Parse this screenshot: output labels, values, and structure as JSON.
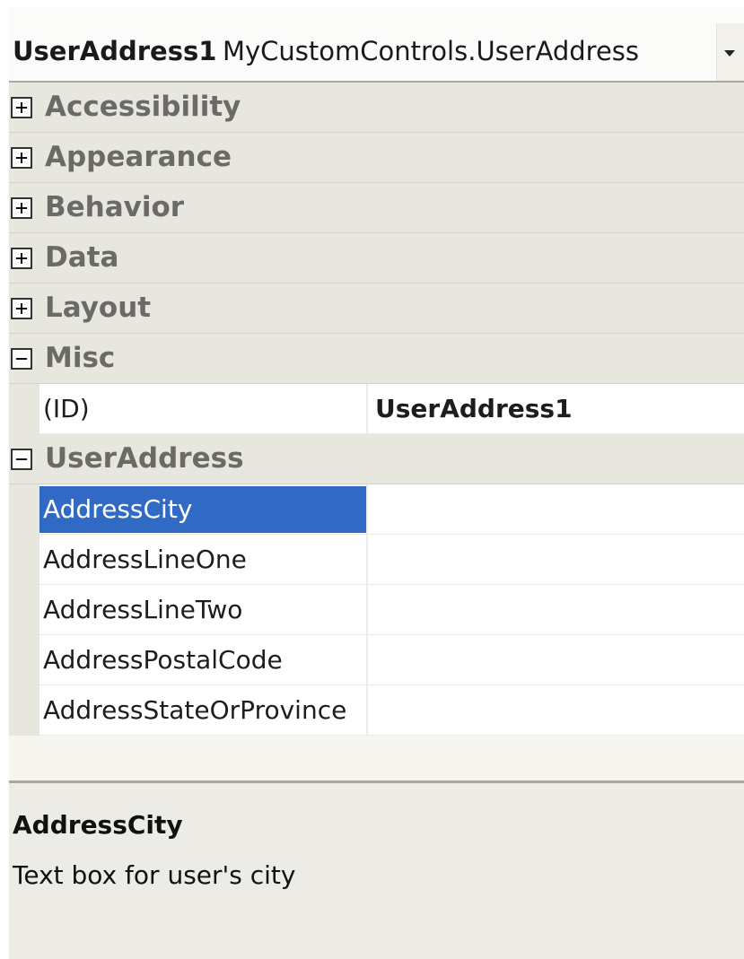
{
  "selector": {
    "object_name": "UserAddress1",
    "object_type": "MyCustomControls.UserAddress"
  },
  "categories": [
    {
      "label": "Accessibility",
      "state": "collapsed"
    },
    {
      "label": "Appearance",
      "state": "collapsed"
    },
    {
      "label": "Behavior",
      "state": "collapsed"
    },
    {
      "label": "Data",
      "state": "collapsed"
    },
    {
      "label": "Layout",
      "state": "collapsed"
    },
    {
      "label": "Misc",
      "state": "expanded"
    },
    {
      "label": "UserAddress",
      "state": "expanded"
    }
  ],
  "misc_properties": [
    {
      "name": "(ID)",
      "value": "UserAddress1"
    }
  ],
  "useraddress_properties": [
    {
      "name": "AddressCity",
      "value": "",
      "selected": true
    },
    {
      "name": "AddressLineOne",
      "value": ""
    },
    {
      "name": "AddressLineTwo",
      "value": ""
    },
    {
      "name": "AddressPostalCode",
      "value": ""
    },
    {
      "name": "AddressStateOrProvince",
      "value": ""
    }
  ],
  "description": {
    "title": "AddressCity",
    "text": "Text box for user's city"
  },
  "colors": {
    "selection": "#316ac5",
    "category_bg": "#e7e6df",
    "category_text": "#6b6a66"
  }
}
